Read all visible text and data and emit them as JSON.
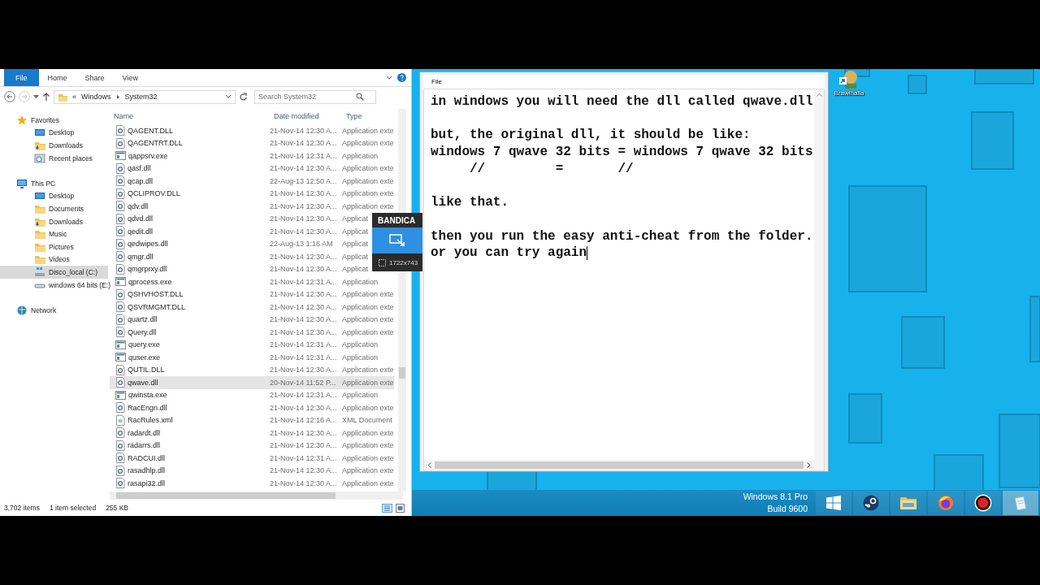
{
  "explorer": {
    "ribbon_tabs": [
      {
        "label": "File",
        "selected": true
      },
      {
        "label": "Home",
        "selected": false
      },
      {
        "label": "Share",
        "selected": false
      },
      {
        "label": "View",
        "selected": false
      }
    ],
    "address": {
      "overflow_marker": "«",
      "path": [
        "Windows",
        "System32"
      ]
    },
    "search": {
      "placeholder": "Search System32"
    },
    "sidebar": [
      {
        "label": "Favorites",
        "kind": "favorites",
        "selected": false,
        "children": [
          {
            "label": "Desktop",
            "kind": "desktop",
            "selected": false
          },
          {
            "label": "Downloads",
            "kind": "downloads",
            "selected": false
          },
          {
            "label": "Recent places",
            "kind": "recent",
            "selected": false
          }
        ]
      },
      {
        "label": "This PC",
        "kind": "pc",
        "selected": false,
        "children": [
          {
            "label": "Desktop",
            "kind": "desktop",
            "selected": false
          },
          {
            "label": "Documents",
            "kind": "folder",
            "selected": false
          },
          {
            "label": "Downloads",
            "kind": "downloads",
            "selected": false
          },
          {
            "label": "Music",
            "kind": "folder",
            "selected": false
          },
          {
            "label": "Pictures",
            "kind": "folder",
            "selected": false
          },
          {
            "label": "Videos",
            "kind": "folder",
            "selected": false
          },
          {
            "label": "Disco_local (C:)",
            "kind": "system-drive",
            "selected": true
          },
          {
            "label": "windows 64 bits (E:)",
            "kind": "drive",
            "selected": false
          }
        ]
      },
      {
        "label": "Network",
        "kind": "network",
        "selected": false
      }
    ],
    "columns": [
      "Name",
      "Date modified",
      "Type"
    ],
    "rows": [
      {
        "name": "QAGENT.DLL",
        "kind": "dll",
        "date": "21-Nov-14 12:30 A...",
        "type": "Application exte",
        "selected": false
      },
      {
        "name": "QAGENTRT.DLL",
        "kind": "dll",
        "date": "21-Nov-14 12:30 A...",
        "type": "Application exte",
        "selected": false
      },
      {
        "name": "qappsrv.exe",
        "kind": "exe",
        "date": "21-Nov-14 12:31 A...",
        "type": "Application",
        "selected": false
      },
      {
        "name": "qasf.dll",
        "kind": "dll",
        "date": "21-Nov-14 12:30 A...",
        "type": "Application exte",
        "selected": false
      },
      {
        "name": "qcap.dll",
        "kind": "dll",
        "date": "22-Aug-13 12:50 A...",
        "type": "Application exte",
        "selected": false
      },
      {
        "name": "QCLIPROV.DLL",
        "kind": "dll",
        "date": "21-Nov-14 12:30 A...",
        "type": "Application exte",
        "selected": false
      },
      {
        "name": "qdv.dll",
        "kind": "dll",
        "date": "21-Nov-14 12:30 A...",
        "type": "Application exte",
        "selected": false
      },
      {
        "name": "qdvd.dll",
        "kind": "dll",
        "date": "21-Nov-14 12:30 A...",
        "type": "Applicat",
        "selected": false
      },
      {
        "name": "qedit.dll",
        "kind": "dll",
        "date": "21-Nov-14 12:30 A...",
        "type": "Applicat",
        "selected": false
      },
      {
        "name": "qedwipes.dll",
        "kind": "dll",
        "date": "22-Aug-13 1:16 AM",
        "type": "Applicat",
        "selected": false
      },
      {
        "name": "qmgr.dll",
        "kind": "dll",
        "date": "21-Nov-14 12:30 A...",
        "type": "Applicat",
        "selected": false
      },
      {
        "name": "qmgrprxy.dll",
        "kind": "dll",
        "date": "21-Nov-14 12:30 A...",
        "type": "Applicat",
        "selected": false
      },
      {
        "name": "qprocess.exe",
        "kind": "exe",
        "date": "21-Nov-14 12:31 A...",
        "type": "Application",
        "selected": false
      },
      {
        "name": "QSHVHOST.DLL",
        "kind": "dll",
        "date": "21-Nov-14 12:30 A...",
        "type": "Application exte",
        "selected": false
      },
      {
        "name": "QSVRMGMT.DLL",
        "kind": "dll",
        "date": "21-Nov-14 12:30 A...",
        "type": "Application exte",
        "selected": false
      },
      {
        "name": "quartz.dll",
        "kind": "dll",
        "date": "21-Nov-14 12:30 A...",
        "type": "Application exte",
        "selected": false
      },
      {
        "name": "Query.dll",
        "kind": "dll",
        "date": "21-Nov-14 12:30 A...",
        "type": "Application exte",
        "selected": false
      },
      {
        "name": "query.exe",
        "kind": "exe",
        "date": "21-Nov-14 12:31 A...",
        "type": "Application",
        "selected": false
      },
      {
        "name": "quser.exe",
        "kind": "exe",
        "date": "21-Nov-14 12:31 A...",
        "type": "Application",
        "selected": false
      },
      {
        "name": "QUTIL.DLL",
        "kind": "dll",
        "date": "21-Nov-14 12:30 A...",
        "type": "Application exte",
        "selected": false
      },
      {
        "name": "qwave.dll",
        "kind": "dll",
        "date": "20-Nov-14 11:52 P...",
        "type": "Application exte",
        "selected": true
      },
      {
        "name": "qwinsta.exe",
        "kind": "exe",
        "date": "21-Nov-14 12:31 A...",
        "type": "Application",
        "selected": false
      },
      {
        "name": "RacEngn.dll",
        "kind": "dll",
        "date": "21-Nov-14 12:30 A...",
        "type": "Application exte",
        "selected": false
      },
      {
        "name": "RacRules.xml",
        "kind": "xml",
        "date": "21-Nov-14 12:16 A...",
        "type": "XML Document",
        "selected": false
      },
      {
        "name": "radardt.dll",
        "kind": "dll",
        "date": "21-Nov-14 12:30 A...",
        "type": "Application exte",
        "selected": false
      },
      {
        "name": "radarrs.dll",
        "kind": "dll",
        "date": "21-Nov-14 12:30 A...",
        "type": "Application exte",
        "selected": false
      },
      {
        "name": "RADCUI.dll",
        "kind": "dll",
        "date": "21-Nov-14 12:31 A...",
        "type": "Application exte",
        "selected": false
      },
      {
        "name": "rasadhlp.dll",
        "kind": "dll",
        "date": "21-Nov-14 12:30 A...",
        "type": "Application exte",
        "selected": false
      },
      {
        "name": "rasapi32.dll",
        "kind": "dll",
        "date": "21-Nov-14 12:30 A...",
        "type": "Application exte",
        "selected": false
      }
    ],
    "status": {
      "count": "3,702 items",
      "selection": "1 item selected",
      "size": "255 KB"
    }
  },
  "recorder_widget": {
    "title": "BANDICA",
    "size": "1722x743"
  },
  "notepad": {
    "menu": [
      "File"
    ],
    "paragraphs": [
      [
        "in windows you will need the dll called qwave.dll"
      ],
      [
        "but, the original dll, it should be like:",
        "windows 7 qwave 32 bits = windows 7 qwave 32 bits",
        "     //         =       //"
      ],
      [
        "like that."
      ],
      [
        "then you run the easy anti-cheat from the folder.",
        "or you can try again"
      ]
    ]
  },
  "desktop_icons": [
    {
      "label": "Brawlhalla"
    }
  ],
  "taskbar": {
    "os_label": [
      "Windows 8.1 Pro",
      "Build 9600"
    ],
    "apps": [
      {
        "kind": "start",
        "selected": false
      },
      {
        "kind": "game-client",
        "selected": false
      },
      {
        "kind": "folder",
        "selected": false
      },
      {
        "kind": "browser",
        "selected": false
      },
      {
        "kind": "recorder",
        "selected": false
      },
      {
        "kind": "notepad",
        "selected": true
      }
    ]
  }
}
